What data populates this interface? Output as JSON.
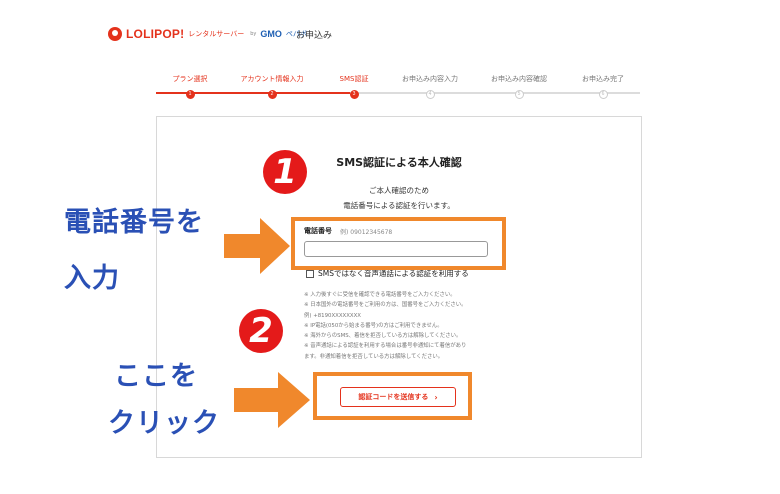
{
  "header": {
    "brand_name": "LOLIPOP!",
    "brand_sub": "レンタルサーバー",
    "brand_by": "by",
    "brand_gmo": "GMO",
    "brand_pepabo": "ペパボ",
    "title": "お申込み"
  },
  "stepper": {
    "steps": [
      {
        "label": "プラン選択",
        "number": "1",
        "status": "done"
      },
      {
        "label": "アカウント情報入力",
        "number": "2",
        "status": "done"
      },
      {
        "label": "SMS認証",
        "number": "3",
        "status": "current"
      },
      {
        "label": "お申込み内容入力",
        "number": "4",
        "status": "todo"
      },
      {
        "label": "お申込み内容確認",
        "number": "5",
        "status": "todo"
      },
      {
        "label": "お申込み完了",
        "number": "6",
        "status": "todo"
      }
    ],
    "progress": 0.4
  },
  "form": {
    "title": "SMS認証による本人確認",
    "desc_line1": "ご本人確認のため",
    "desc_line2": "電話番号による認証を行います。",
    "phone_label": "電話番号",
    "phone_example": "例) 09012345678",
    "phone_value": "",
    "voice_label": "SMSではなく音声通話による認証を利用する",
    "notes": [
      "※ 入力後すぐに受信を確認できる電話番号をご入力ください。",
      "※ 日本国外の電話番号をご利用の方は、国番号をご入力ください。",
      "例) +8190XXXXXXXX",
      "※ IP電話(050から始まる番号)の方はご利用できません。",
      "※ 海外からのSMS、着信を拒否している方は解除してください。",
      "※ 音声通話による認証を利用する場合は番号非通知にて着信があり",
      "ます。非通知着信を拒否している方は解除してください。"
    ],
    "send_label": "認証コードを送信する",
    "send_chevron": "›"
  },
  "annotations": {
    "badge1": "1",
    "badge2": "2",
    "step1_line1": "電話番号を",
    "step1_line2": "入力",
    "step2_line1": "ここを",
    "step2_line2": "クリック",
    "accent_color": "#f0882c",
    "badge_color": "#e41a1a",
    "text_color": "#2a50b5"
  },
  "colors": {
    "brand": "#e4321c",
    "gmo": "#1e5fb3"
  }
}
